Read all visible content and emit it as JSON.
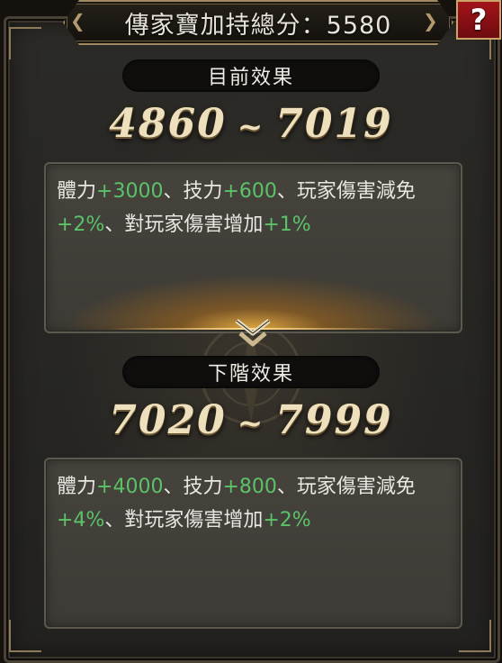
{
  "title": {
    "label": "傳家寶加持總分",
    "separator": "：",
    "score": "5580"
  },
  "help_label": "?",
  "current": {
    "header": "目前效果",
    "range_min": "4860",
    "range_sep": "~",
    "range_max": "7019",
    "line1": [
      {
        "t": "體力",
        "c": "w"
      },
      {
        "t": "+3000",
        "c": "g"
      },
      {
        "t": "、技力",
        "c": "w"
      },
      {
        "t": "+600",
        "c": "g"
      },
      {
        "t": "、玩家傷害減免",
        "c": "w"
      }
    ],
    "line2": [
      {
        "t": "+2%",
        "c": "g"
      },
      {
        "t": "、對玩家傷害增加",
        "c": "w"
      },
      {
        "t": "+1%",
        "c": "g"
      }
    ]
  },
  "next": {
    "header": "下階效果",
    "range_min": "7020",
    "range_sep": "~",
    "range_max": "7999",
    "line1": [
      {
        "t": "體力",
        "c": "w"
      },
      {
        "t": "+4000",
        "c": "g"
      },
      {
        "t": "、技力",
        "c": "w"
      },
      {
        "t": "+800",
        "c": "g"
      },
      {
        "t": "、玩家傷害減免",
        "c": "w"
      }
    ],
    "line2": [
      {
        "t": "+4%",
        "c": "g"
      },
      {
        "t": "、對玩家傷害增加",
        "c": "w"
      },
      {
        "t": "+2%",
        "c": "g"
      }
    ]
  },
  "icons": {
    "arrow": "double-chevron-down-icon",
    "help": "question-mark-icon"
  },
  "colors": {
    "bonus_green": "#5cc26a",
    "help_red": "#a3141a",
    "gold": "#efe0bd"
  }
}
